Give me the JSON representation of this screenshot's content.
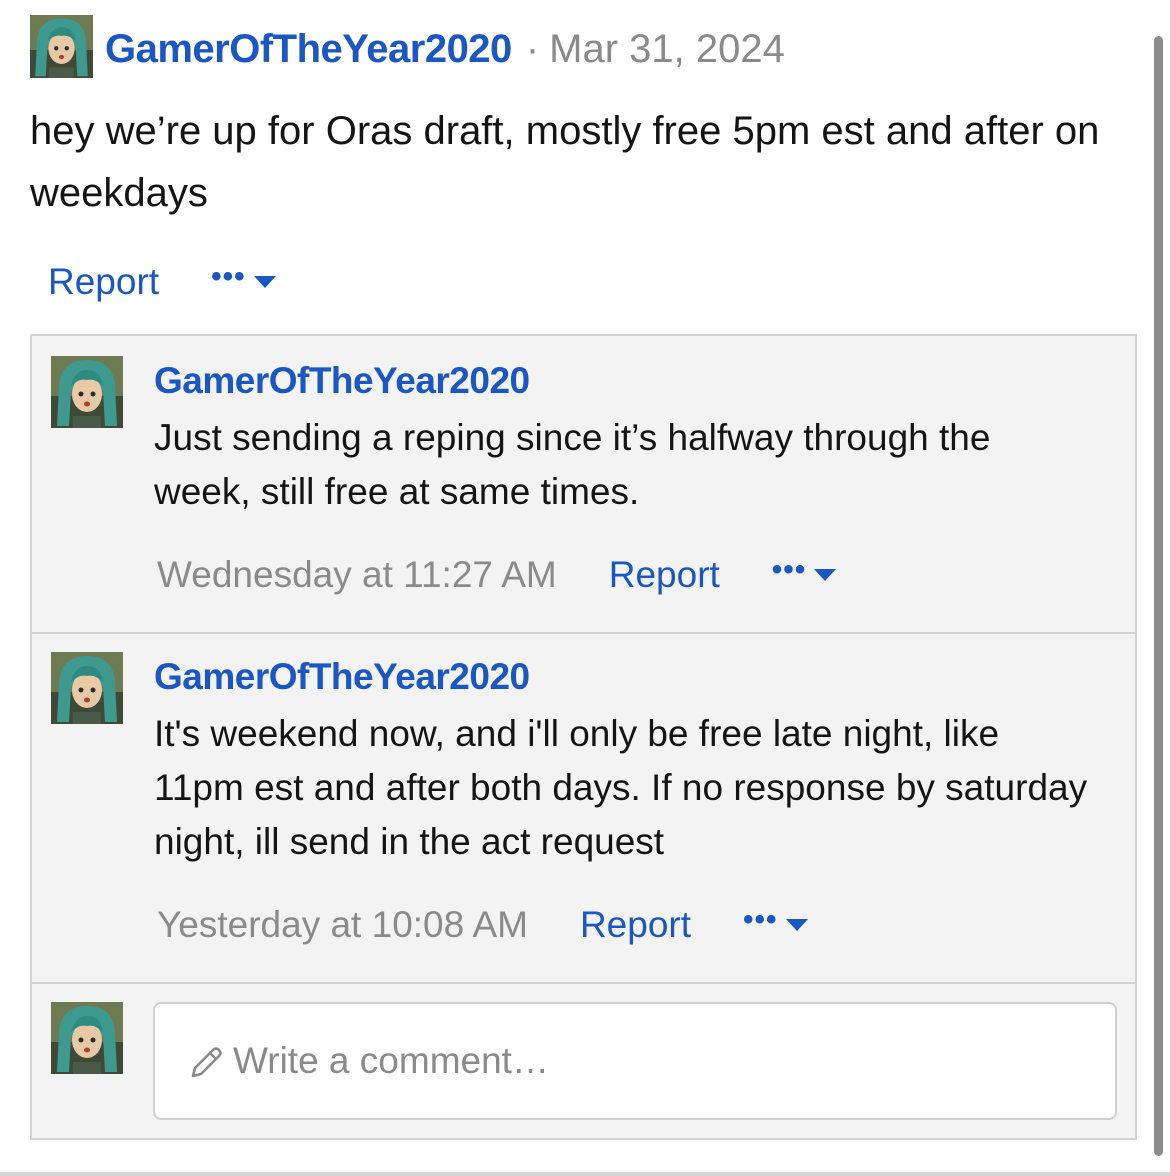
{
  "post": {
    "username": "GamerOfTheYear2020",
    "separator": "·",
    "date": "Mar 31, 2024",
    "body": "hey we’re up for Oras draft, mostly free 5pm est and after on weekdays",
    "report_label": "Report",
    "more_label": "•••"
  },
  "comments": [
    {
      "username": "GamerOfTheYear2020",
      "text": "Just sending a reping since it’s halfway through the week, still free at same times.",
      "time": "Wednesday at 11:27 AM",
      "report_label": "Report",
      "more_label": "•••"
    },
    {
      "username": "GamerOfTheYear2020",
      "text": "It's weekend now, and i'll only be free late night, like 11pm est and after both days. If no response by saturday night, ill send in the act request",
      "time": "Yesterday at 10:08 AM",
      "report_label": "Report",
      "more_label": "•••"
    }
  ],
  "composer": {
    "placeholder": "Write a comment…",
    "icon": "pencil-icon"
  },
  "colors": {
    "link": "#1a56c4",
    "muted": "#8a8a8a",
    "panel_bg": "#f3f3f3",
    "border": "#d3d3d3"
  }
}
